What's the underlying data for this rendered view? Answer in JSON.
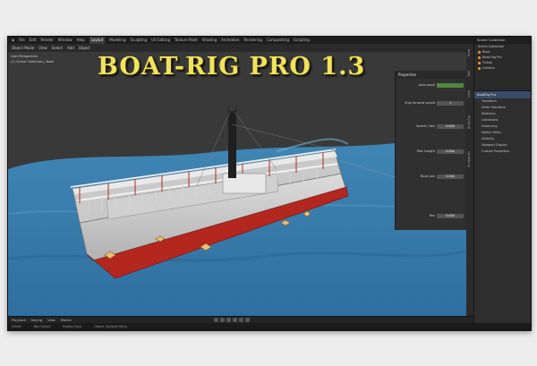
{
  "topbar": {
    "menus": [
      "File",
      "Edit",
      "Render",
      "Window",
      "Help"
    ],
    "workspaces": [
      "Layout",
      "Modeling",
      "Sculpting",
      "UV Editing",
      "Texture Paint",
      "Shading",
      "Animation",
      "Rendering",
      "Compositing",
      "Scripting"
    ],
    "active_workspace": "Layout"
  },
  "viewport": {
    "header_items": [
      "Object Mode",
      "View",
      "Select",
      "Add",
      "Object"
    ],
    "info_lines": [
      "User Perspective",
      "(1) Scene Collection | Boat"
    ]
  },
  "banner": {
    "title": "BOAT-RIG PRO 1.3"
  },
  "npanel": {
    "header": "Properties",
    "rows": [
      {
        "label": "Auto wave",
        "value": "",
        "green": true
      },
      {
        "label": "Ship forward speed",
        "value": "1"
      },
      {
        "label": "Speed / Yaw",
        "value": "0.000"
      },
      {
        "label": "Max Length",
        "value": "0.000"
      },
      {
        "label": "Boat size",
        "value": "0.000"
      },
      {
        "label": "Res",
        "value": "0.000"
      }
    ]
  },
  "vtabs": [
    "Item",
    "Tool",
    "View",
    "Boat-Rig",
    "Animation"
  ],
  "outliner": {
    "title": "Scene Collection",
    "items": [
      "Scene Collection",
      "Boat",
      "Boat-Rig Pro",
      "Ocean",
      "Camera"
    ]
  },
  "properties": {
    "header": "BoatRig Pro",
    "items": [
      "Transform",
      "Delta Transform",
      "Relations",
      "Collections",
      "Instancing",
      "Motion Paths",
      "Visibility",
      "Viewport Display",
      "Custom Properties"
    ]
  },
  "timeline": {
    "items": [
      "Playback",
      "Keying",
      "View",
      "Marker"
    ]
  },
  "statusbar": {
    "items": [
      "Select",
      "Box Select",
      "Rotate View",
      "Object Context Menu"
    ]
  }
}
